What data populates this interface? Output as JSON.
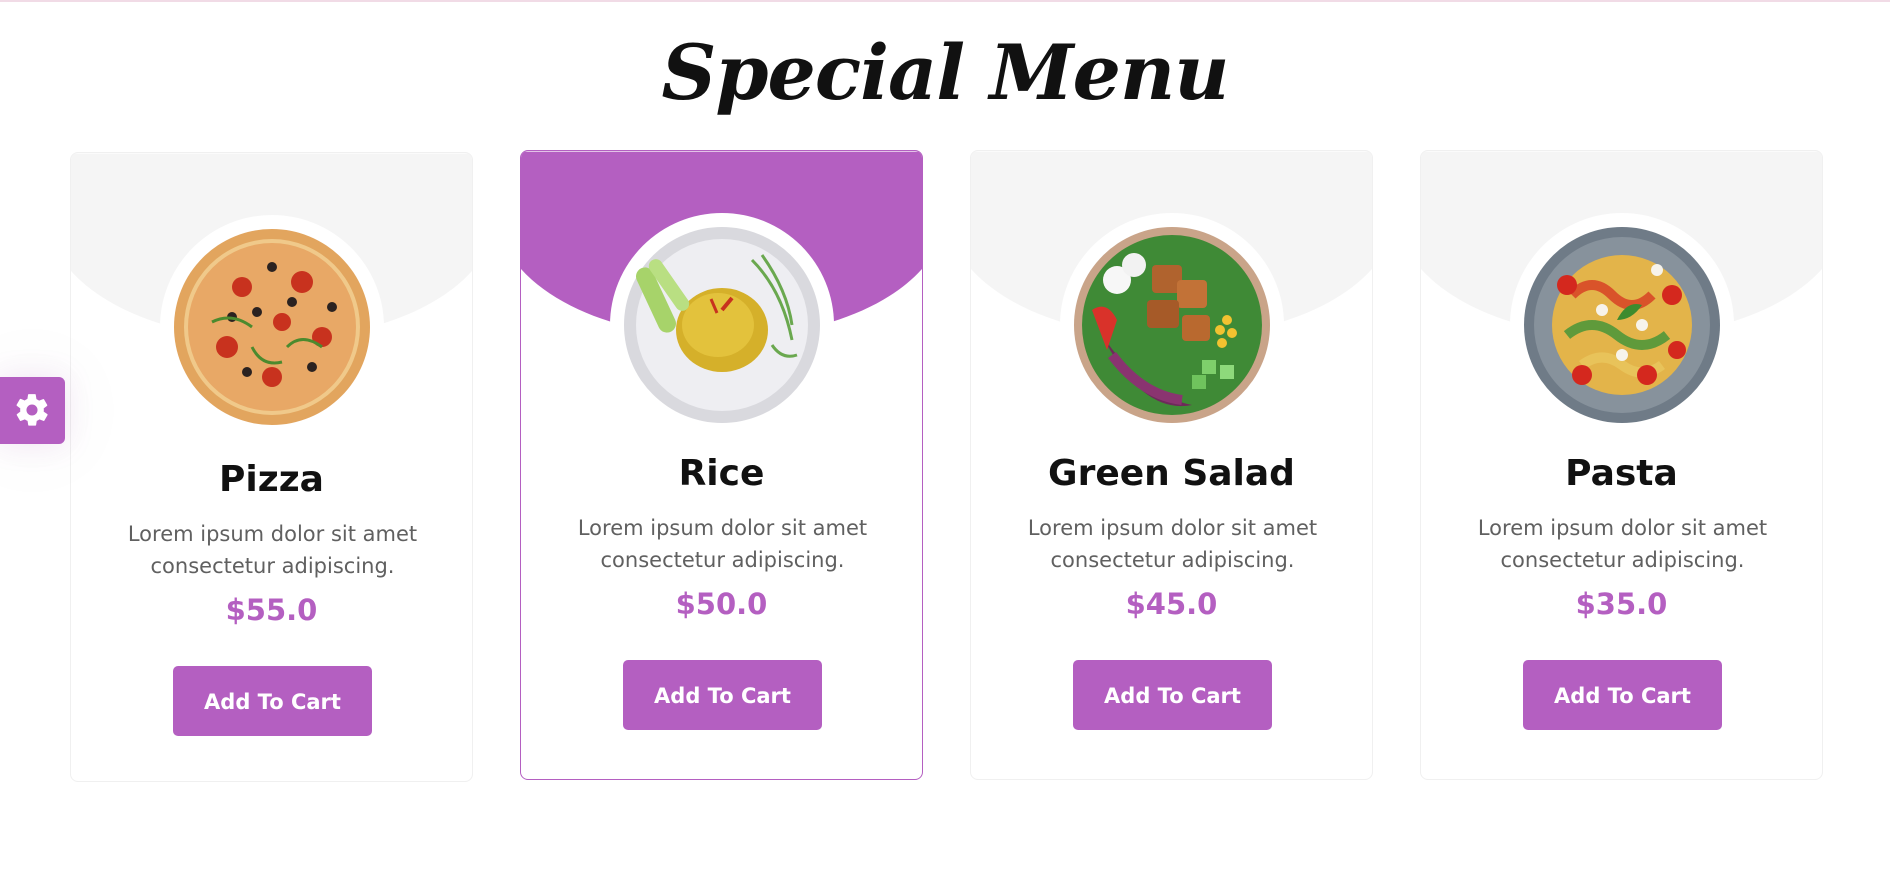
{
  "page": {
    "title": "Special Menu"
  },
  "colors": {
    "accent": "#b45fc1",
    "card_bg_shape": "#f5f5f5",
    "price": "#b45fc1",
    "button_text": "#ffffff"
  },
  "settings_button": {
    "icon": "gear-icon"
  },
  "cards": [
    {
      "name": "Pizza",
      "description": "Lorem ipsum dolor sit amet consectetur adipiscing.",
      "price": "$55.0",
      "button_label": "Add To Cart",
      "image": "pizza-image",
      "active": false
    },
    {
      "name": "Rice",
      "description": "Lorem ipsum dolor sit amet consectetur adipiscing.",
      "price": "$50.0",
      "button_label": "Add To Cart",
      "image": "rice-image",
      "active": true
    },
    {
      "name": "Green Salad",
      "description": "Lorem ipsum dolor sit amet consectetur adipiscing.",
      "price": "$45.0",
      "button_label": "Add To Cart",
      "image": "salad-image",
      "active": false
    },
    {
      "name": "Pasta",
      "description": "Lorem ipsum dolor sit amet consectetur adipiscing.",
      "price": "$35.0",
      "button_label": "Add To Cart",
      "image": "pasta-image",
      "active": false
    }
  ]
}
